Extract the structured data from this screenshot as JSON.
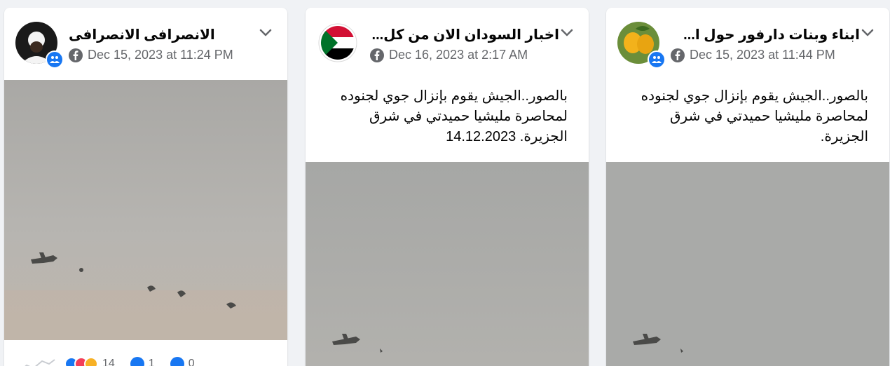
{
  "colors": {
    "background": "#f0f2f5",
    "card": "#ffffff",
    "primary_text": "#050505",
    "secondary_text": "#65676b",
    "accent": "#1877f2"
  },
  "posts": [
    {
      "page_name": "الانصرافى الانصرافى",
      "date": "Dec 15, 2023 at 11:24 PM",
      "caption": "",
      "avatar": "man-in-turban-avatar",
      "reactions": {
        "count": "14",
        "comments": "1",
        "shares": "0"
      }
    },
    {
      "page_name": "اخبار السودان الان من كل...",
      "date": "Dec 16, 2023 at 2:17 AM",
      "caption": "بالصور..الجيش يقوم بإنزال جوي لجنوده لمحاصرة مليشيا حميدتي في شرق الجزيرة. 14.12.2023",
      "avatar": "sudan-flag-avatar"
    },
    {
      "page_name": "ابناء وبنات دارفور حول ا...",
      "date": "Dec 15, 2023 at 11:44 PM",
      "caption": "بالصور..الجيش يقوم بإنزال جوي لجنوده لمحاصرة مليشيا حميدتي في شرق الجزيرة.",
      "avatar": "mango-fruit-avatar"
    }
  ]
}
